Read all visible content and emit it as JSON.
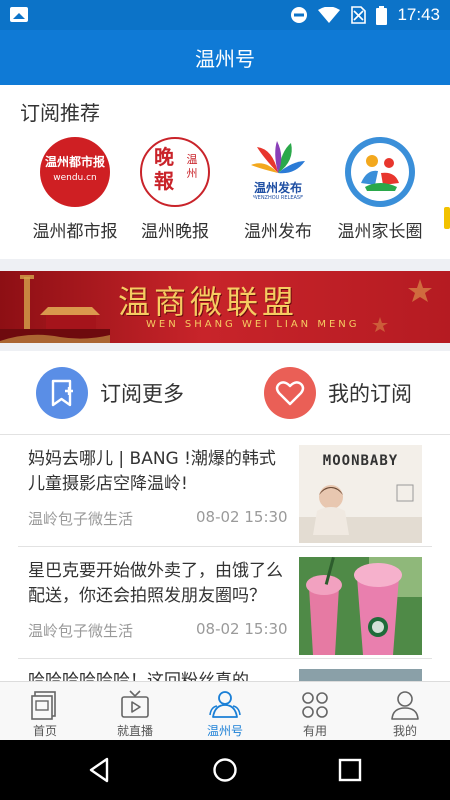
{
  "status_bar": {
    "time": "17:43",
    "icons": [
      "image-icon",
      "dnd-icon",
      "wifi-icon",
      "no-sim-icon",
      "battery-icon"
    ]
  },
  "app_title": "温州号",
  "subscribe_section": {
    "title": "订阅推荐",
    "items": [
      {
        "name": "温州都市报",
        "logo_text": "温州都市报",
        "logo_sub": "wendu.cn"
      },
      {
        "name": "温州晚报",
        "logo_text": "晚報",
        "logo_side": "温州"
      },
      {
        "name": "温州发布",
        "logo_text": "温州发布",
        "logo_sub": "WENZHOU RELEASE"
      },
      {
        "name": "温州家长圈",
        "logo_text": ""
      }
    ]
  },
  "banner": {
    "title": "温商微联盟",
    "subtitle": "WEN SHANG WEI LIAN MENG"
  },
  "actions": {
    "subscribe_more": {
      "label": "订阅更多",
      "color": "#5a8ee6",
      "icon": "bookmark-plus-icon"
    },
    "my_subscriptions": {
      "label": "我的订阅",
      "color": "#ea5f56",
      "icon": "heart-icon"
    }
  },
  "news": [
    {
      "title": "妈妈去哪儿 | BANG !潮爆的韩式儿童摄影店空降温岭!",
      "source": "温岭包子微生活",
      "time": "08-02 15:30",
      "thumb_text": "MOONBABY"
    },
    {
      "title": "星巴克要开始做外卖了，由饿了么配送，你还会拍照发朋友圈吗？",
      "source": "温岭包子微生活",
      "time": "08-02 15:30",
      "thumb_text": ""
    },
    {
      "title": "哈哈哈哈哈哈！这回粉丝真的",
      "source": "",
      "time": "",
      "thumb_text": ""
    }
  ],
  "bottom_nav": [
    {
      "label": "首页",
      "icon": "newspaper-icon",
      "active": false
    },
    {
      "label": "就直播",
      "icon": "tv-play-icon",
      "active": false
    },
    {
      "label": "温州号",
      "icon": "people-icon",
      "active": true
    },
    {
      "label": "有用",
      "icon": "grid-icon",
      "active": false
    },
    {
      "label": "我的",
      "icon": "person-icon",
      "active": false
    }
  ],
  "colors": {
    "primary": "#0f7ad6",
    "status_bar": "#0c73c8",
    "accent_blue": "#1a7fd6",
    "banner_red": "#c8242a",
    "banner_gold": "#f6cc62"
  }
}
